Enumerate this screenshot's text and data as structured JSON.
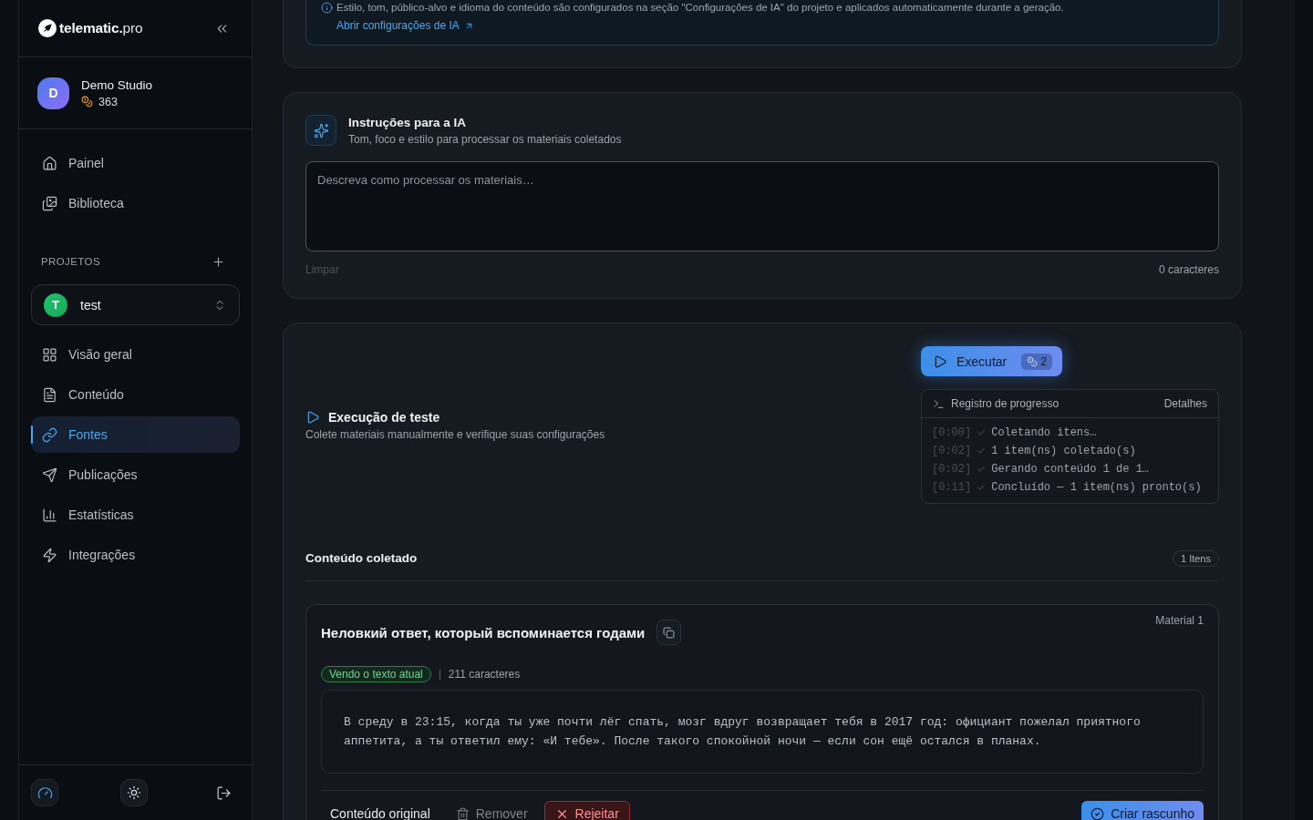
{
  "sidebar": {
    "logo": "**telematic.**pro",
    "account": {
      "initial": "D",
      "name": "Demo Studio",
      "credits": "363"
    },
    "nav": [
      {
        "label": "Painel",
        "selected": false
      },
      {
        "label": "Biblioteca",
        "selected": false
      }
    ],
    "projects": {
      "title": "PROJETOS",
      "current": {
        "initial": "T",
        "name": "test"
      },
      "nav": [
        {
          "label": "Visão geral",
          "selected": false
        },
        {
          "label": "Conteúdo",
          "selected": false
        },
        {
          "label": "Fontes",
          "selected": true
        },
        {
          "label": "Publicações",
          "selected": false
        },
        {
          "label": "Estatísticas",
          "selected": false
        },
        {
          "label": "Integrações",
          "selected": false
        }
      ]
    }
  },
  "ai_notice": {
    "text": "Estilo, tom, público-alvo e idioma do conteúdo são configurados na seção \"Configurações de IA\" do projeto e aplicados automaticamente durante a geração.",
    "link": "Abrir configurações de IA"
  },
  "instructions": {
    "title": "Instruções para a IA",
    "subtitle": "Tom, foco e estilo para processar os materiais coletados",
    "placeholder": "Descreva como processar os materiais…",
    "clear": {
      "label": "Limpar",
      "disabled": true
    },
    "count": "0 caracteres"
  },
  "test_run": {
    "title": "Execução de teste",
    "subtitle": "Colete materiais manualmente e verifique suas configurações",
    "run": {
      "label": "Executar",
      "cost": "2"
    },
    "log": {
      "title": "Registro de progresso",
      "details": "Detalhes",
      "entries": [
        {
          "time": "[0:00]",
          "text": "Coletando itens…",
          "done": true
        },
        {
          "time": "[0:02]",
          "text": "1 item(ns) coletado(s)",
          "done": true
        },
        {
          "time": "[0:02]",
          "text": "Gerando conteúdo 1 de 1…",
          "done": true
        },
        {
          "time": "[0:11]",
          "text": "Concluído — 1 item(ns) pronto(s)",
          "done": true
        }
      ]
    }
  },
  "collected": {
    "title": "Conteúdo coletado",
    "count": "1 Itens",
    "items": [
      {
        "label": "Material 1",
        "title": "Неловкий ответ, который вспоминается годами",
        "status": "Vendo o texto atual",
        "chars": "211 caracteres",
        "text": "В среду в 23:15, когда ты уже почти лёг спать, мозг вдруг возвращает тебя в 2017 год: официант пожелал приятного аппетита, а ты ответил ему: «И тебе». После такого спокойной ночи — если сон ещё остался в планах.",
        "original": "Conteúdo original",
        "remove": "Remover",
        "reject": "Rejeitar",
        "draft": "Criar rascunho"
      }
    ]
  }
}
